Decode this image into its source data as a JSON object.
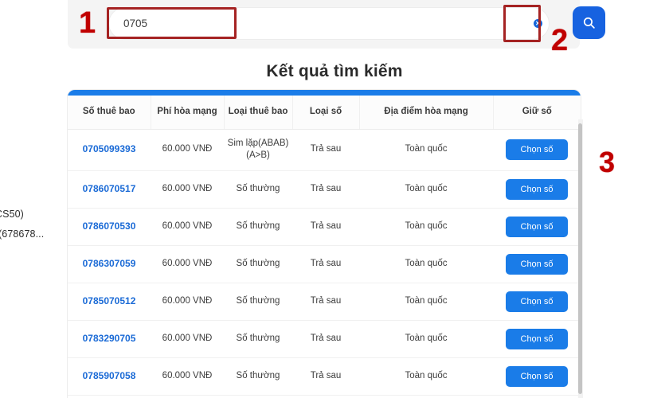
{
  "background_text": {
    "snippet_1": "CS50)",
    "snippet_2": "(678678..."
  },
  "search": {
    "value": "0705",
    "placeholder": "",
    "clear_icon": "close-circle-icon",
    "search_icon": "search-icon",
    "search_button_label": ""
  },
  "annotations": {
    "step_1": "1",
    "step_2": "2",
    "step_3": "3"
  },
  "results": {
    "title": "Kết quả tìm kiếm",
    "columns": [
      "Số thuê bao",
      "Phí hòa mạng",
      "Loại thuê bao",
      "Loại số",
      "Địa điểm hòa mạng",
      "Giữ số"
    ],
    "action_label": "Chọn số",
    "rows": [
      {
        "msisdn": "0705099393",
        "fee": "60.000 VNĐ",
        "sim_type": "Sim lặp(ABAB) (A>B)",
        "number_type": "Trả sau",
        "place": "Toàn quốc",
        "action": "Chọn số"
      },
      {
        "msisdn": "0786070517",
        "fee": "60.000 VNĐ",
        "sim_type": "Số thường",
        "number_type": "Trả sau",
        "place": "Toàn quốc",
        "action": "Chọn số"
      },
      {
        "msisdn": "0786070530",
        "fee": "60.000 VNĐ",
        "sim_type": "Số thường",
        "number_type": "Trả sau",
        "place": "Toàn quốc",
        "action": "Chọn số"
      },
      {
        "msisdn": "0786307059",
        "fee": "60.000 VNĐ",
        "sim_type": "Số thường",
        "number_type": "Trả sau",
        "place": "Toàn quốc",
        "action": "Chọn số"
      },
      {
        "msisdn": "0785070512",
        "fee": "60.000 VNĐ",
        "sim_type": "Số thường",
        "number_type": "Trả sau",
        "place": "Toàn quốc",
        "action": "Chọn số"
      },
      {
        "msisdn": "0783290705",
        "fee": "60.000 VNĐ",
        "sim_type": "Số thường",
        "number_type": "Trả sau",
        "place": "Toàn quốc",
        "action": "Chọn số"
      },
      {
        "msisdn": "0785907058",
        "fee": "60.000 VNĐ",
        "sim_type": "Số thường",
        "number_type": "Trả sau",
        "place": "Toàn quốc",
        "action": "Chọn số"
      }
    ]
  },
  "colors": {
    "primary_blue": "#1a7ce8",
    "link_blue": "#1a6ad6",
    "annotation_red": "#c00000",
    "annotation_box": "#a52323",
    "panel_gray": "#f4f4f4"
  }
}
